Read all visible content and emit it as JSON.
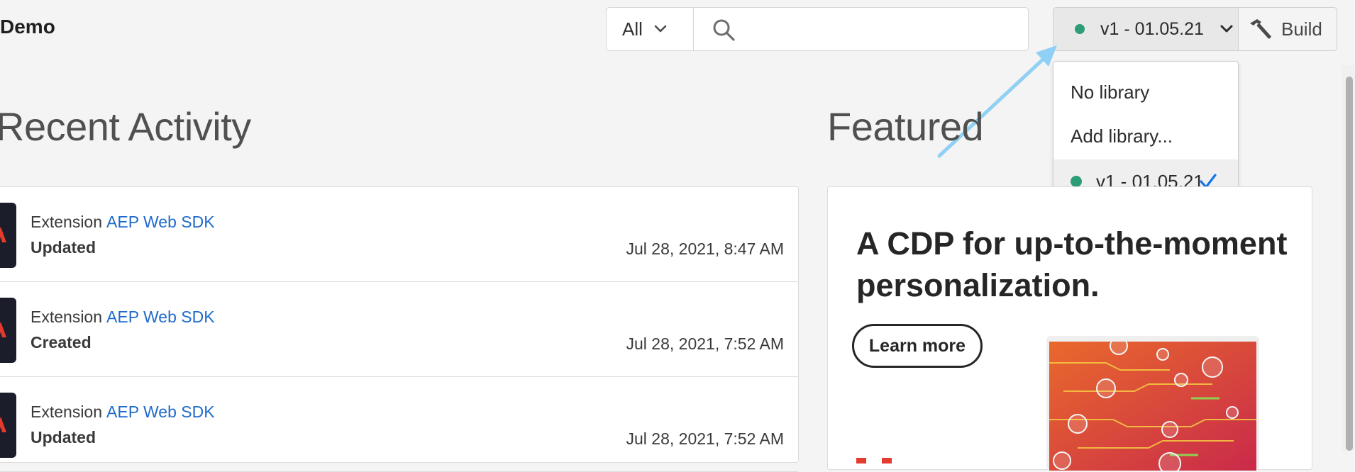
{
  "header": {
    "property_name": "Demo",
    "search": {
      "scope": "All",
      "placeholder": "",
      "value": ""
    },
    "library_picker": {
      "label": "v1 - 01.05.21",
      "status_color": "#2d9d78"
    },
    "build_label": "Build"
  },
  "library_menu": {
    "items": [
      {
        "label": "No library"
      },
      {
        "label": "Add library..."
      },
      {
        "label": "v1 - 01.05.21",
        "selected": true
      }
    ]
  },
  "recent_activity": {
    "heading": "Recent Activity",
    "rows": [
      {
        "type": "Extension",
        "name": "AEP Web SDK",
        "action": "Updated",
        "time": "Jul 28, 2021, 8:47 AM"
      },
      {
        "type": "Extension",
        "name": "AEP Web SDK",
        "action": "Created",
        "time": "Jul 28, 2021, 7:52 AM"
      },
      {
        "type": "Extension",
        "name": "AEP Web SDK",
        "action": "Updated",
        "time": "Jul 28, 2021, 7:52 AM"
      }
    ]
  },
  "featured": {
    "heading": "Featured",
    "promo_title": "A CDP for up-to-the-moment personalization.",
    "cta_label": "Learn more"
  },
  "colors": {
    "accent_link": "#1f6acb",
    "status_green": "#2d9d78",
    "annotation_arrow": "#8fd0f4",
    "checkmark": "#1473e6"
  }
}
